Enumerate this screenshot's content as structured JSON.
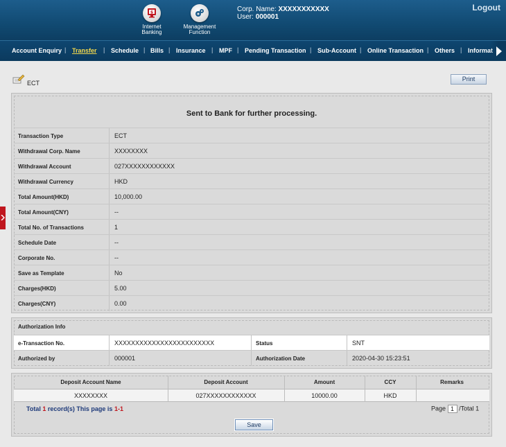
{
  "header": {
    "internet_banking_label": "Internet Banking",
    "management_function_label": "Management Function",
    "corp_name_label": "Corp. Name:",
    "corp_name_value": "XXXXXXXXXXX",
    "user_label": "User:",
    "user_value": "000001",
    "logout_label": "Logout"
  },
  "nav": {
    "items": [
      "Account Enquiry",
      "Transfer",
      "Schedule",
      "Bills",
      "Insurance",
      "MPF",
      "Pending Transaction",
      "Sub-Account",
      "Online Transaction",
      "Others",
      "Informat"
    ],
    "active": "Transfer"
  },
  "page": {
    "title": "ECT",
    "print_label": "Print",
    "status_message": "Sent to Bank for further processing."
  },
  "details": [
    {
      "label": "Transaction Type",
      "value": "ECT"
    },
    {
      "label": "Withdrawal Corp. Name",
      "value": "XXXXXXXX"
    },
    {
      "label": "Withdrawal Account",
      "value": "027XXXXXXXXXXXX"
    },
    {
      "label": "Withdrawal Currency",
      "value": "HKD"
    },
    {
      "label": "Total Amount(HKD)",
      "value": "10,000.00"
    },
    {
      "label": "Total Amount(CNY)",
      "value": "--"
    },
    {
      "label": "Total No. of Transactions",
      "value": "1"
    },
    {
      "label": "Schedule Date",
      "value": "--"
    },
    {
      "label": "Corporate No.",
      "value": "--"
    },
    {
      "label": "Save as Template",
      "value": "No"
    },
    {
      "label": "Charges(HKD)",
      "value": "5.00"
    },
    {
      "label": "Charges(CNY)",
      "value": "0.00"
    }
  ],
  "authorization": {
    "title": "Authorization Info",
    "etx_label": "e-Transaction No.",
    "etx_value": "XXXXXXXXXXXXXXXXXXXXXXXX",
    "status_label": "Status",
    "status_value": "SNT",
    "authorized_by_label": "Authorized by",
    "authorized_by_value": "000001",
    "auth_date_label": "Authorization Date",
    "auth_date_value": "2020-04-30 15:23:51"
  },
  "deposit_table": {
    "headers": [
      "Deposit Account Name",
      "Deposit Account",
      "Amount",
      "CCY",
      "Remarks"
    ],
    "rows": [
      [
        "XXXXXXXX",
        "027XXXXXXXXXXXX",
        "10000.00",
        "HKD",
        ""
      ]
    ],
    "summary_prefix": "Total",
    "summary_count": "1",
    "summary_mid": "record(s) This page is",
    "summary_range": "1-1",
    "page_label": "Page",
    "page_value": "1",
    "page_total": "/Total 1"
  },
  "save_label": "Save"
}
